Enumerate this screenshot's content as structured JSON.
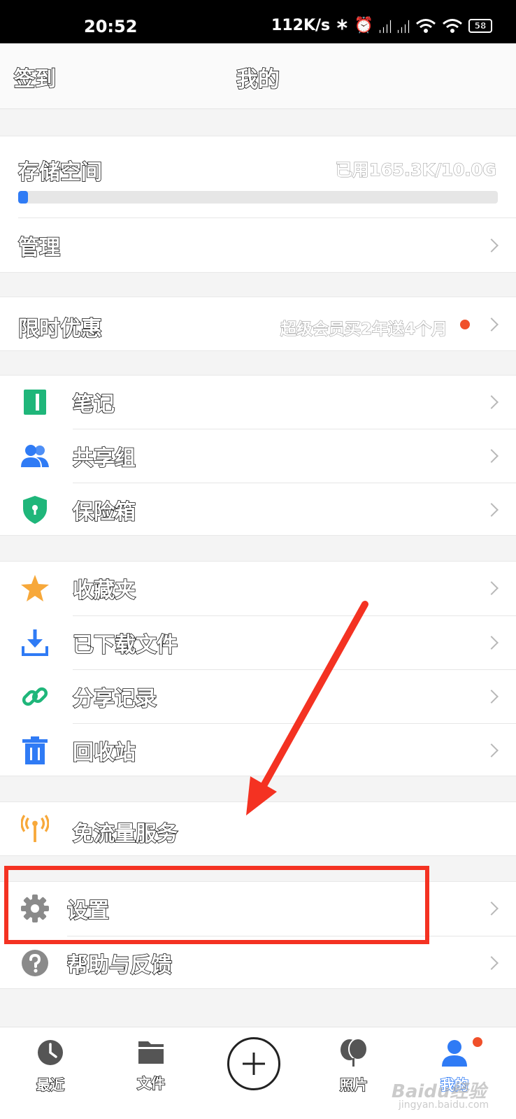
{
  "status_bar": {
    "time": "20:52",
    "net_speed": "112K/s",
    "battery": "58"
  },
  "header": {
    "left_action": "签到",
    "title": "我的"
  },
  "storage": {
    "label": "存储空间",
    "used_text": "已用165.3K/10.0G",
    "used_fraction": 2e-05,
    "manage_label": "管理"
  },
  "promo": {
    "label": "限时优惠",
    "text": "超级会员买2年送4个月"
  },
  "group1": [
    {
      "label": "笔记",
      "icon": "note-icon"
    },
    {
      "label": "共享组",
      "icon": "users-icon"
    },
    {
      "label": "保险箱",
      "icon": "shield-lock-icon"
    }
  ],
  "group2": [
    {
      "label": "收藏夹",
      "icon": "star-icon"
    },
    {
      "label": "已下载文件",
      "icon": "download-icon"
    },
    {
      "label": "分享记录",
      "icon": "link-icon"
    },
    {
      "label": "回收站",
      "icon": "trash-icon"
    }
  ],
  "free_traffic": {
    "label": "免流量服务",
    "icon": "antenna-icon"
  },
  "settings_group": [
    {
      "label": "设置",
      "icon": "gear-icon"
    },
    {
      "label": "帮助与反馈",
      "icon": "help-icon"
    }
  ],
  "tabbar": {
    "tabs": [
      {
        "label": "最近",
        "icon": "clock-icon"
      },
      {
        "label": "文件",
        "icon": "folder-icon"
      },
      {
        "label": "照片",
        "icon": "photos-icon"
      },
      {
        "label": "我的",
        "icon": "person-icon"
      }
    ],
    "add_icon": "plus-icon"
  },
  "watermark": {
    "main": "Baidu经验",
    "sub": "jingyan.baidu.com"
  },
  "colors": {
    "accent_blue": "#2f7bf5",
    "annotation_red": "#f43222",
    "badge_red": "#f0502a",
    "note_green": "#1fb67a",
    "star_orange": "#f7a83a"
  }
}
